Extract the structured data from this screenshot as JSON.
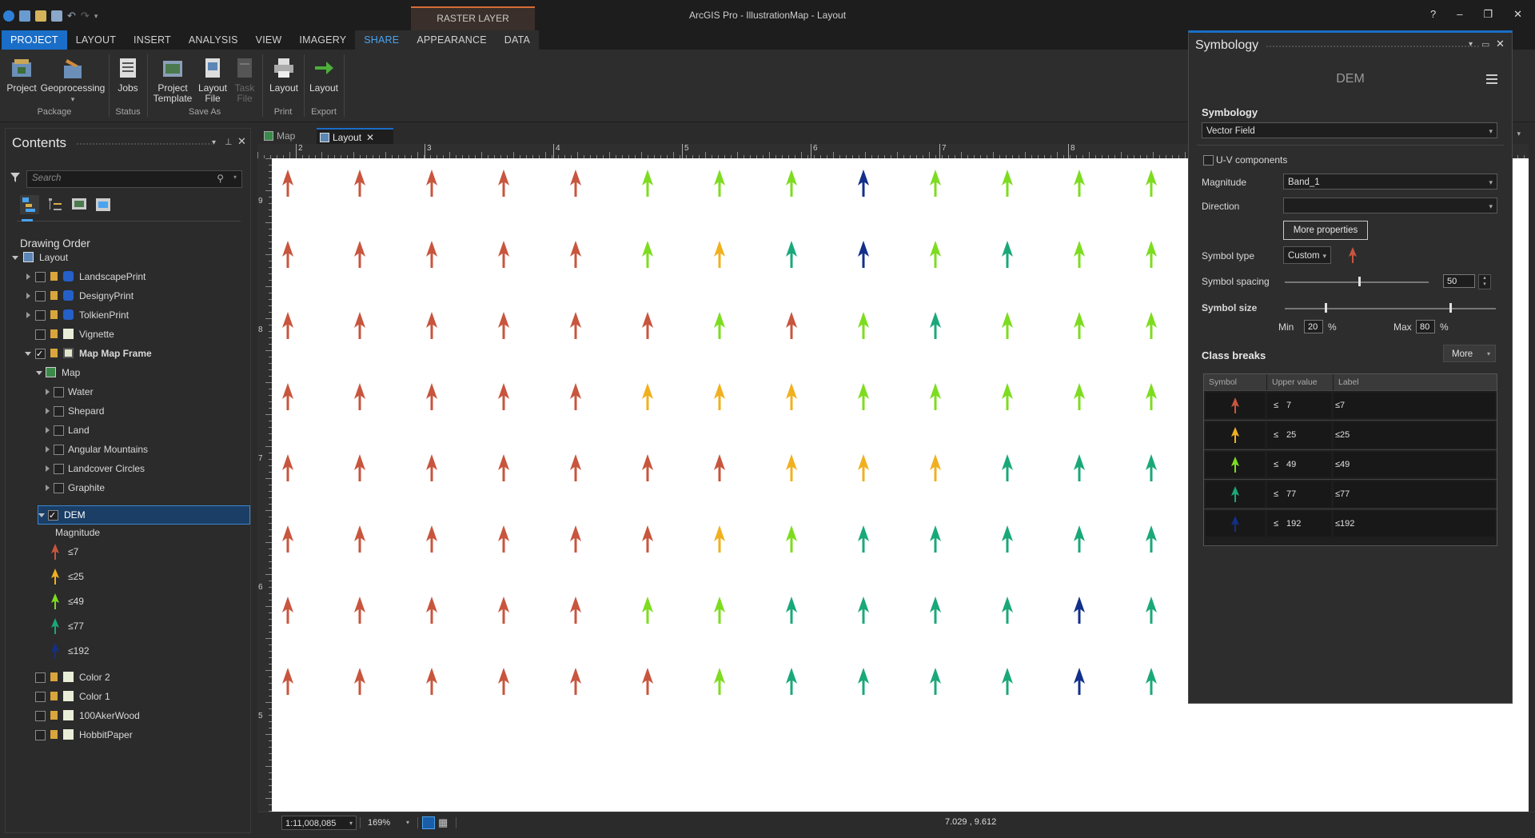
{
  "app": {
    "title": "ArcGIS Pro - IllustrationMap - Layout",
    "contextual_tab_group": "RASTER LAYER",
    "window_controls": [
      "?",
      "–",
      "❐",
      "✕"
    ]
  },
  "ribbon_tabs": [
    "PROJECT",
    "LAYOUT",
    "INSERT",
    "ANALYSIS",
    "VIEW",
    "IMAGERY",
    "SHARE",
    "APPEARANCE",
    "DATA"
  ],
  "ribbon": {
    "buttons": {
      "project": "Project",
      "geoprocessing": "Geoprocessing",
      "jobs": "Jobs",
      "project_template_1": "Project",
      "project_template_2": "Template",
      "layout_file_1": "Layout",
      "layout_file_2": "File",
      "task_file_1": "Task",
      "task_file_2": "File",
      "print_layout": "Layout",
      "export_layout": "Layout"
    },
    "groups": {
      "package": "Package",
      "status": "Status",
      "save_as": "Save As",
      "print": "Print",
      "export": "Export"
    }
  },
  "contents": {
    "title": "Contents",
    "search_placeholder": "Search",
    "drawing_order": "Drawing Order",
    "layers": {
      "layout": "Layout",
      "landscape": "LandscapePrint",
      "designy": "DesignyPrint",
      "tolkien": "TolkienPrint",
      "vignette": "Vignette",
      "mapframe": "Map Map Frame",
      "map": "Map",
      "water": "Water",
      "shepard": "Shepard",
      "land": "Land",
      "angular": "Angular Mountains",
      "landcover": "Landcover Circles",
      "graphite": "Graphite",
      "dem": "DEM",
      "magnitude": "Magnitude",
      "color2": "Color 2",
      "color1": "Color 1",
      "aker": "100AkerWood",
      "hobbit": "HobbitPaper"
    },
    "legend": [
      "≤7",
      "≤25",
      "≤49",
      "≤77",
      "≤192"
    ]
  },
  "map_tabs": {
    "map": "Map",
    "layout": "Layout"
  },
  "ruler_labels": [
    "2",
    "3",
    "4",
    "5",
    "6",
    "7",
    "8"
  ],
  "ruler_v_labels": [
    "9",
    "8",
    "7",
    "6",
    "5"
  ],
  "status": {
    "scale": "1:11,008,085",
    "zoom": "169%",
    "coords": "7.029 , 9.612"
  },
  "class_colors": [
    "#c8553d",
    "#f0b01f",
    "#7ddc1f",
    "#1aa87a",
    "#12308a"
  ],
  "symbology": {
    "title": "Symbology",
    "layer": "DEM",
    "section": "Symbology",
    "renderer": "Vector Field",
    "uv_label": "U-V components",
    "magnitude_label": "Magnitude",
    "magnitude_value": "Band_1",
    "direction_label": "Direction",
    "direction_value": "",
    "more_properties": "More properties",
    "symbol_type_label": "Symbol type",
    "symbol_type_value": "Custom",
    "spacing_label": "Symbol spacing",
    "spacing_value": "50",
    "size_label": "Symbol size",
    "min_label": "Min",
    "min_value": "20",
    "max_label": "Max",
    "max_value": "80",
    "pct": "%",
    "class_breaks": "Class breaks",
    "more": "More",
    "col_symbol": "Symbol",
    "col_upper": "Upper value",
    "col_label": "Label",
    "le": "≤",
    "breaks": [
      {
        "upper": "7",
        "label": "≤7"
      },
      {
        "upper": "25",
        "label": "≤25"
      },
      {
        "upper": "49",
        "label": "≤49"
      },
      {
        "upper": "77",
        "label": "≤77"
      },
      {
        "upper": "192",
        "label": "≤192"
      }
    ]
  }
}
